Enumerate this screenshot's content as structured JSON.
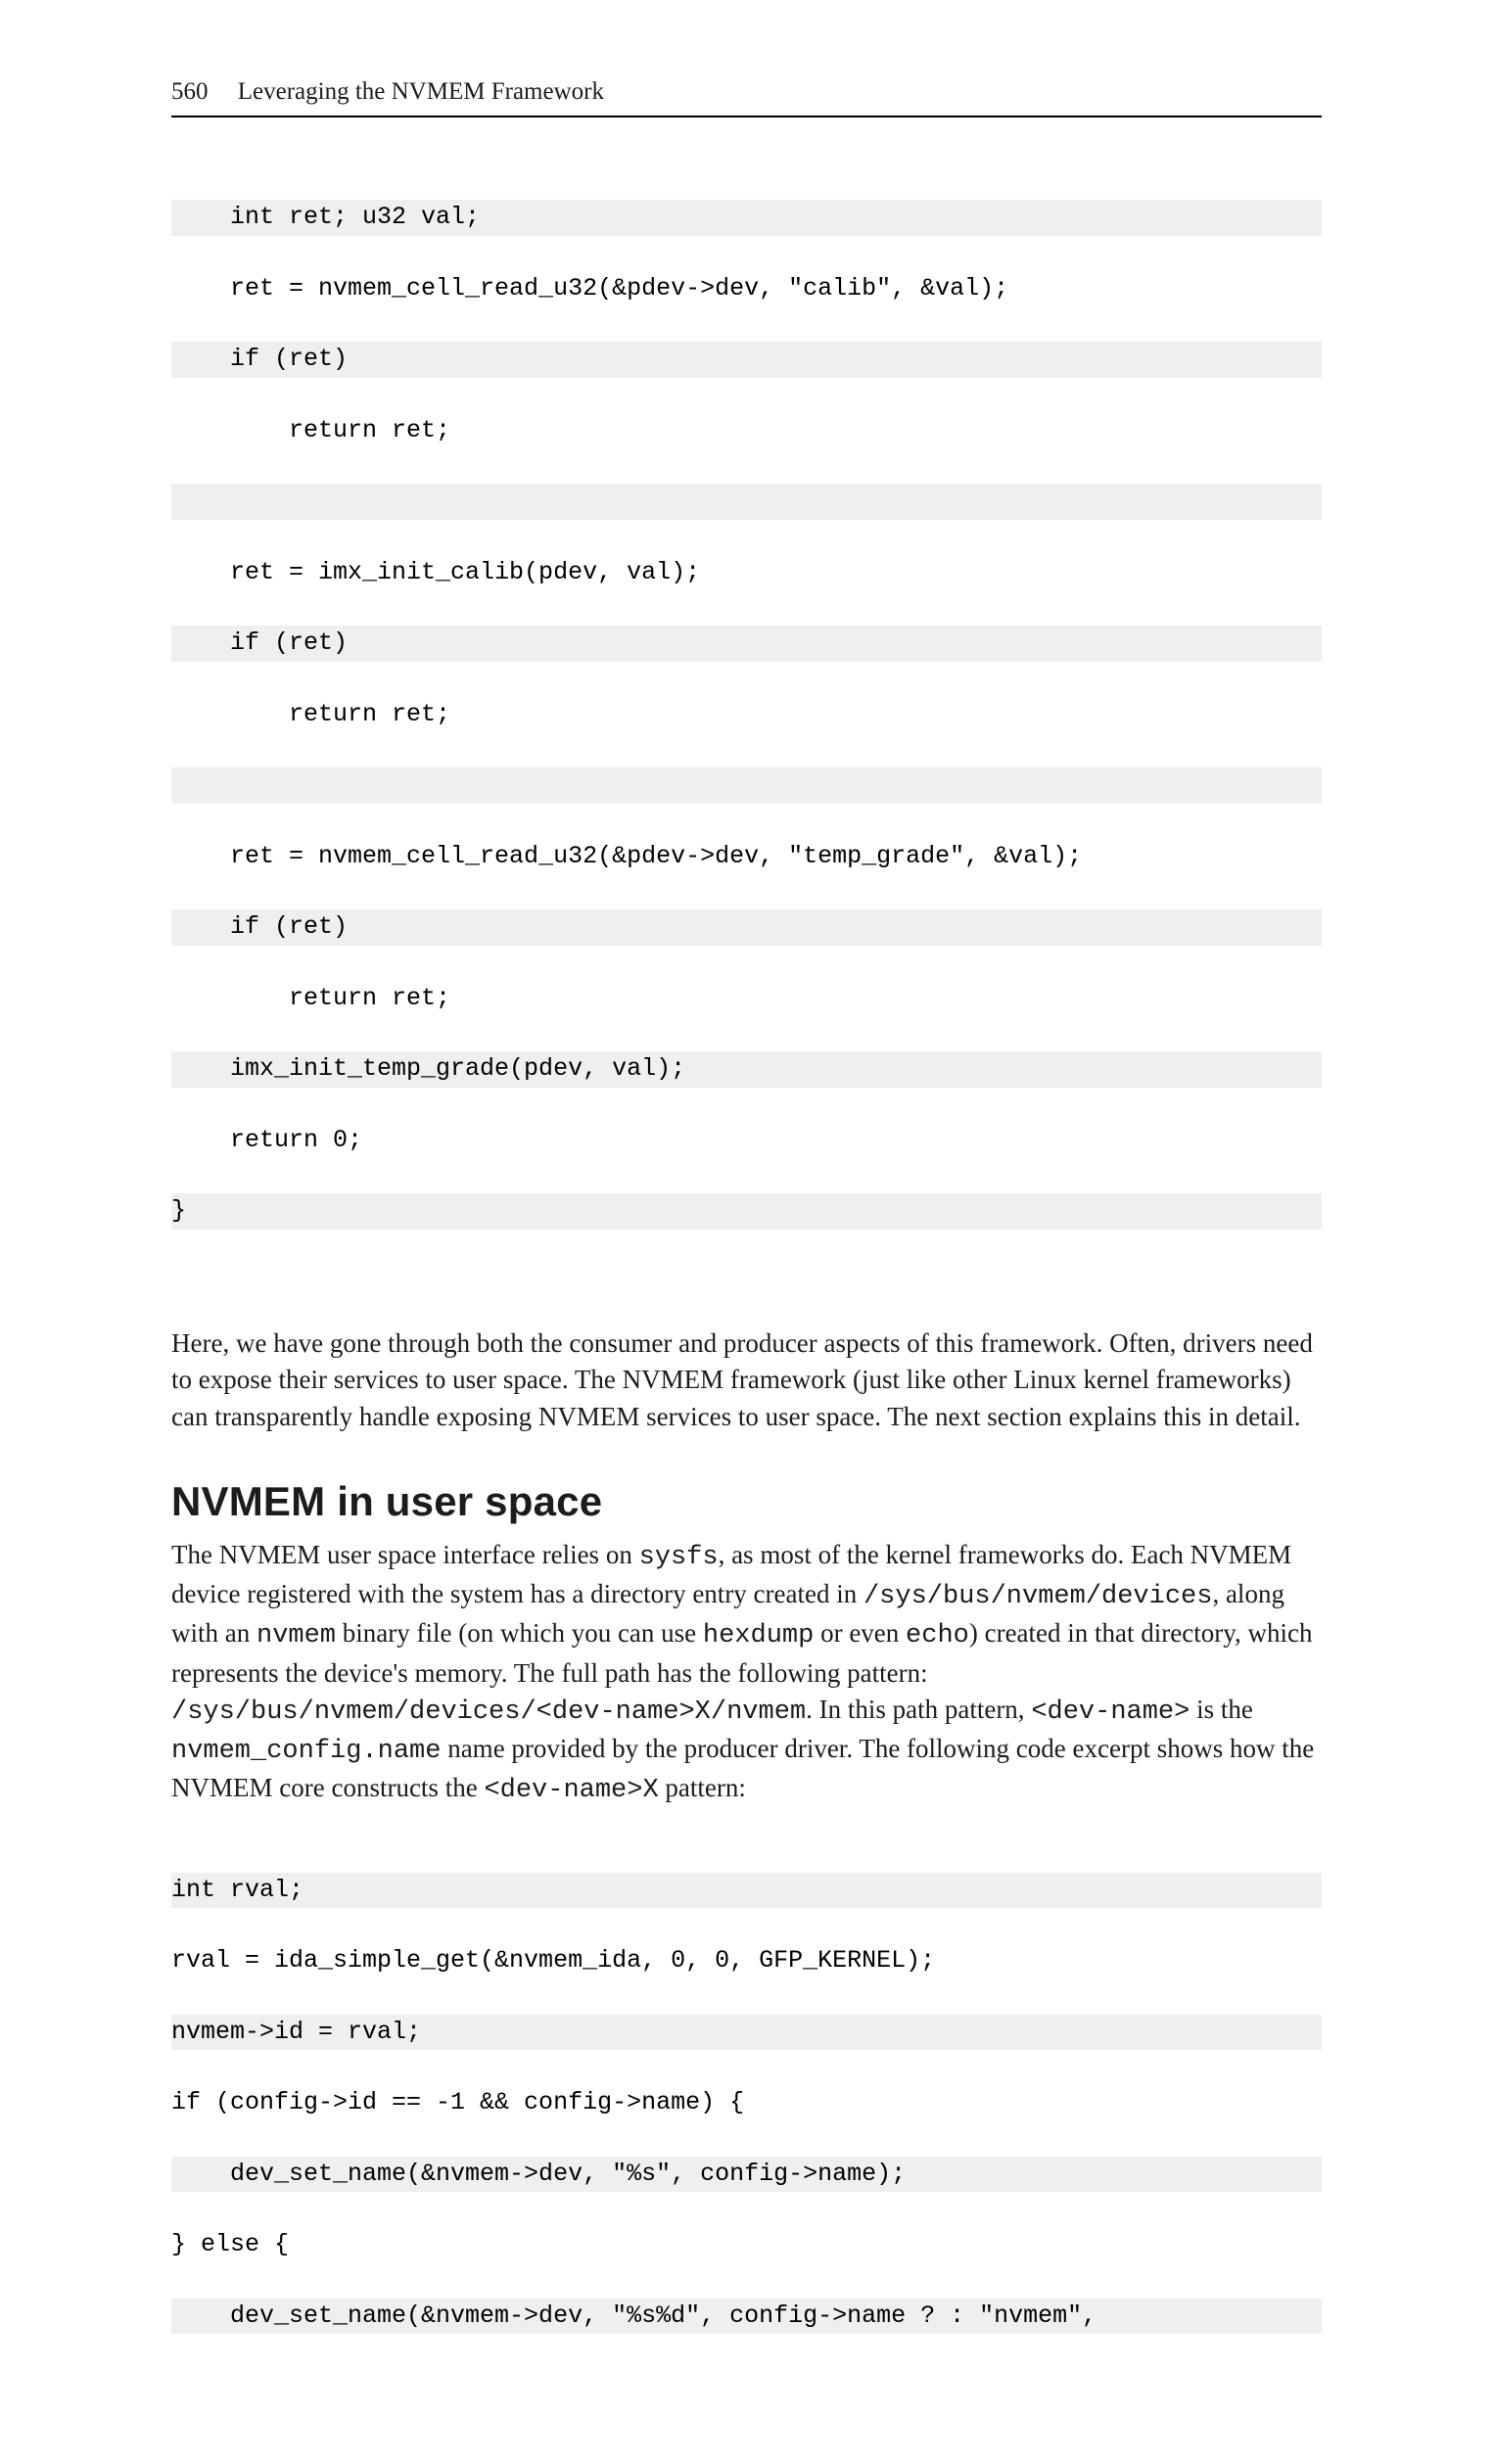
{
  "header": {
    "page_number": "560",
    "running_title": "Leveraging the NVMEM Framework"
  },
  "code1": {
    "l0": "    int ret; u32 val;",
    "l1": "    ret = nvmem_cell_read_u32(&pdev->dev, \"calib\", &val);",
    "l2": "    if (ret)",
    "l3": "        return ret;",
    "l4": " ",
    "l5": "    ret = imx_init_calib(pdev, val);",
    "l6": "    if (ret)",
    "l7": "        return ret;",
    "l8": " ",
    "l9": "    ret = nvmem_cell_read_u32(&pdev->dev, \"temp_grade\", &val);",
    "l10": "    if (ret)",
    "l11": "        return ret;",
    "l12": "    imx_init_temp_grade(pdev, val);",
    "l13": "    return 0;",
    "l14": "}"
  },
  "para1": {
    "t0": "Here, we have gone through both the consumer and producer aspects of this framework. Often, drivers need to expose their services to user space. The NVMEM framework (just like other Linux kernel frameworks) can transparently handle exposing NVMEM services to user space. The next section explains this in detail."
  },
  "section": {
    "title": "NVMEM in user space"
  },
  "para2": {
    "t0": "The NVMEM user space interface relies on ",
    "m0": "sysfs",
    "t1": ", as most of the kernel frameworks do. Each NVMEM device registered with the system has a directory entry created in ",
    "m1": "/sys/bus/nvmem/devices",
    "t2": ", along with an ",
    "m2": "nvmem",
    "t3": " binary file (on which you can use ",
    "m3": "hexdump",
    "t4": " or even ",
    "m4": "echo",
    "t5": ") created in that directory, which represents the device's memory. The full path has the following pattern: ",
    "m5": "/sys/bus/nvmem/devices/<dev-name>X/nvmem",
    "t6": ". In this path pattern, ",
    "m6": "<dev-name>",
    "t7": " is the ",
    "m7": "nvmem_config.name",
    "t8": " name provided by the producer driver. The following code excerpt shows how the NVMEM core constructs the ",
    "m8": "<dev-name>X",
    "t9": " pattern:"
  },
  "code2": {
    "l0": "int rval;",
    "l1": "rval = ida_simple_get(&nvmem_ida, 0, 0, GFP_KERNEL);",
    "l2": "nvmem->id = rval;",
    "l3": "if (config->id == -1 && config->name) {",
    "l4": "    dev_set_name(&nvmem->dev, \"%s\", config->name);",
    "l5": "} else {",
    "l6": "    dev_set_name(&nvmem->dev, \"%s%d\", config->name ? : \"nvmem\","
  }
}
